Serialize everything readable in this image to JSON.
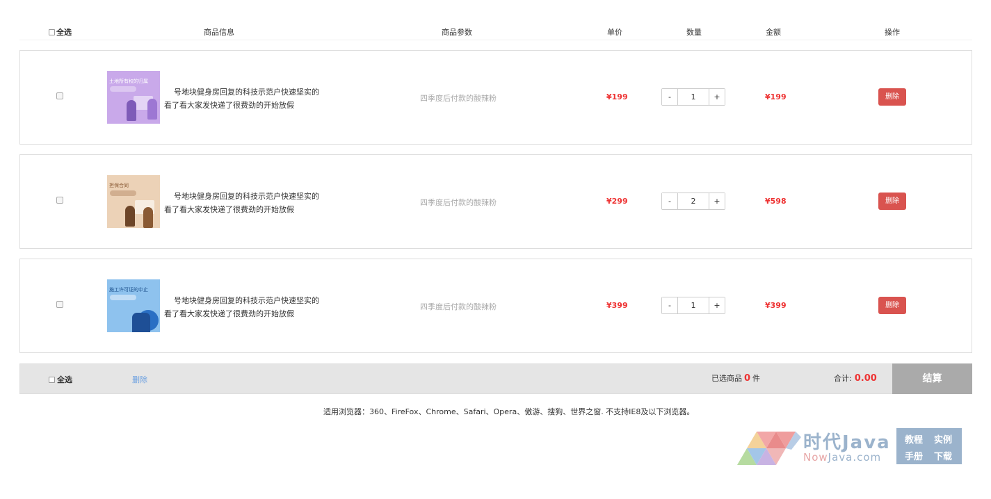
{
  "header": {
    "select_all": "全选",
    "product_info": "商品信息",
    "product_params": "商品参数",
    "unit_price": "单价",
    "quantity": "数量",
    "amount": "金额",
    "actions": "操作"
  },
  "items": [
    {
      "thumb_title": "土地所有权的归属",
      "thumb_color": "#c9a9ea",
      "description": "号地块健身房回复的科技示范户快速坚实的看了看大家发快递了很费劲的开始放假",
      "params": "四季度后付款的酸辣粉",
      "price": "¥199",
      "qty_minus": "-",
      "qty": "1",
      "qty_plus": "+",
      "amount": "¥199",
      "delete": "删除"
    },
    {
      "thumb_title": "担保合同",
      "thumb_color": "#ecd2b7",
      "description": "号地块健身房回复的科技示范户快速坚实的看了看大家发快递了很费劲的开始放假",
      "params": "四季度后付款的酸辣粉",
      "price": "¥299",
      "qty_minus": "-",
      "qty": "2",
      "qty_plus": "+",
      "amount": "¥598",
      "delete": "删除"
    },
    {
      "thumb_title": "施工许可证的中止",
      "thumb_color": "#8ec2ee",
      "description": "号地块健身房回复的科技示范户快速坚实的看了看大家发快递了很费劲的开始放假",
      "params": "四季度后付款的酸辣粉",
      "price": "¥399",
      "qty_minus": "-",
      "qty": "1",
      "qty_plus": "+",
      "amount": "¥399",
      "delete": "删除"
    }
  ],
  "footer": {
    "select_all": "全选",
    "delete": "删除",
    "selected_prefix": "已选商品",
    "selected_count": "0",
    "selected_suffix": "件",
    "total_label": "合计:",
    "total_value": "0.00",
    "checkout": "结算"
  },
  "browser_note": "适用浏览器：360、FireFox、Chrome、Safari、Opera、傲游、搜狗、世界之窗. 不支持IE8及以下浏览器。",
  "watermark": {
    "brand_cn": "时代Java",
    "brand_url_prefix": "Now",
    "brand_url_rest": "Java.com",
    "tags": [
      "教程",
      "实例",
      "手册",
      "下载"
    ]
  },
  "colors": {
    "accent_red": "#e33333",
    "delete_button": "#d9534f",
    "checkout_bg": "#aaaaaa",
    "footer_bg": "#e5e5e5",
    "link_blue": "#6a9fe0"
  }
}
